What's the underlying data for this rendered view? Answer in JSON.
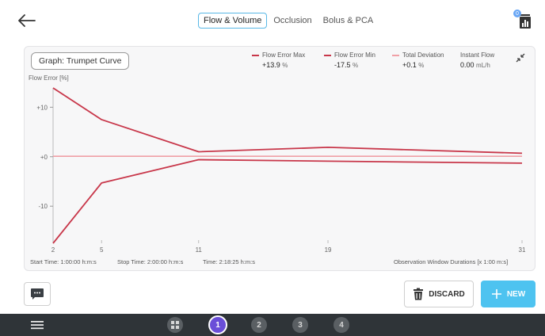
{
  "header": {
    "tabs": [
      {
        "label": "Flow & Volume",
        "active": true
      },
      {
        "label": "Occlusion",
        "active": false
      },
      {
        "label": "Bolus & PCA",
        "active": false
      }
    ],
    "device_badge": "0"
  },
  "card": {
    "graph_button": "Graph: Trumpet Curve",
    "y_axis_title": "Flow Error [%]",
    "legend": [
      {
        "label": "Flow Error Max",
        "value": "+13.9",
        "unit": "%",
        "color": "#c8374a"
      },
      {
        "label": "Flow Error Min",
        "value": "-17.5",
        "unit": "%",
        "color": "#c8374a"
      },
      {
        "label": "Total Deviation",
        "value": "+0.1",
        "unit": "%",
        "color": "#f0a0a6"
      },
      {
        "label": "Instant Flow",
        "value": "0.00",
        "unit": "mL/h",
        "color": ""
      }
    ],
    "footer": {
      "start_time": "Start Time: 1:00:00 h:m:s",
      "stop_time": "Stop Time: 2:00:00 h:m:s",
      "time": "Time: 2:18:25 h:m:s",
      "x_axis_label": "Observation Window Durations [x 1:00 m:s]"
    }
  },
  "chart_data": {
    "type": "line",
    "title": "Trumpet Curve",
    "xlabel": "Observation Window Durations [x 1:00 m:s]",
    "ylabel": "Flow Error [%]",
    "x_ticks": [
      2,
      5,
      11,
      19,
      31
    ],
    "y_ticks": [
      {
        "value": 10,
        "label": "+10"
      },
      {
        "value": 0,
        "label": "+0"
      },
      {
        "value": -10,
        "label": "-10"
      }
    ],
    "xlim": [
      2,
      31
    ],
    "ylim": [
      -17.5,
      13.9
    ],
    "series": [
      {
        "name": "Flow Error Max",
        "color": "#c8374a",
        "x": [
          2,
          5,
          11,
          19,
          31
        ],
        "y": [
          13.9,
          7.5,
          1.0,
          1.9,
          0.7
        ]
      },
      {
        "name": "Flow Error Min",
        "color": "#c8374a",
        "x": [
          2,
          5,
          11,
          19,
          31
        ],
        "y": [
          -17.5,
          -5.3,
          -0.6,
          -0.9,
          -1.3
        ]
      },
      {
        "name": "Total Deviation",
        "color": "#f0a0a6",
        "x": [
          2,
          31
        ],
        "y": [
          0.1,
          0.1
        ]
      }
    ]
  },
  "actions": {
    "discard_label": "DISCARD",
    "new_label": "NEW"
  },
  "navbar": {
    "steps": [
      "1",
      "2",
      "3",
      "4"
    ],
    "active_step": "1"
  }
}
